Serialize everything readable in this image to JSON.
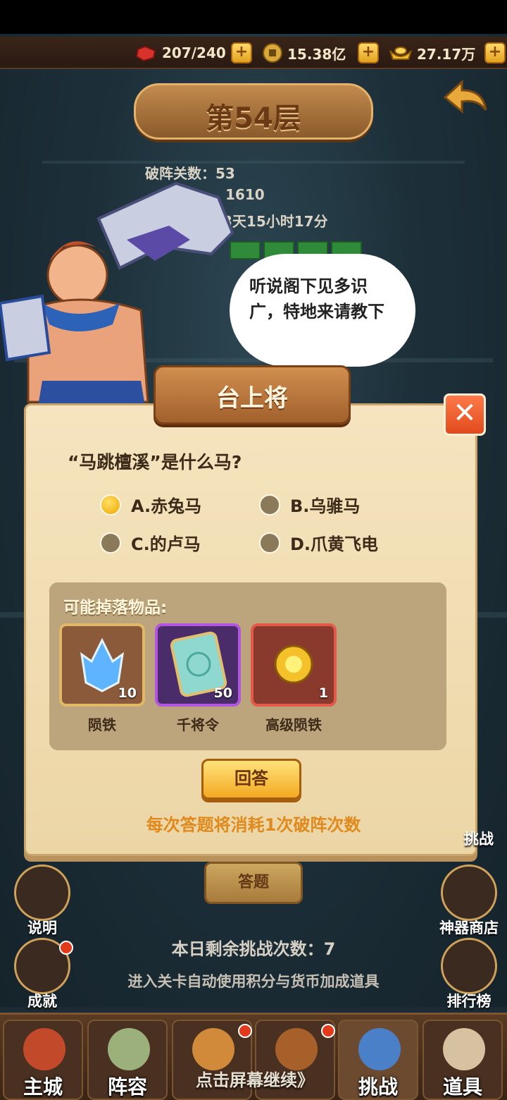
{
  "top_bar": {
    "stamina": "207/240",
    "coins": "15.38亿",
    "ingots": "27.17万",
    "plus": "+"
  },
  "floor": {
    "title": "第54层"
  },
  "info": {
    "line1": "破阵关数：53",
    "line2": "1610",
    "line3": "闭：3天15小时17分"
  },
  "speech": {
    "text": "听说阁下见多识广，特地来请教下"
  },
  "dialog": {
    "title": "台上将",
    "close": "✕",
    "question": "“马跳檀溪”是什么马?",
    "options": [
      {
        "label": "A.赤兔马",
        "selected": true
      },
      {
        "label": "B.乌骓马",
        "selected": false
      },
      {
        "label": "C.的卢马",
        "selected": false
      },
      {
        "label": "D.爪黄飞电",
        "selected": false
      }
    ],
    "drops_title": "可能掉落物品:",
    "drops": [
      {
        "name": "陨铁",
        "count": "10",
        "border": "#e0b866",
        "bg": "#8a5a3a",
        "icon": "blue-crystal-icon"
      },
      {
        "name": "千将令",
        "count": "50",
        "border": "#b255e0",
        "bg": "#4a2c6a",
        "icon": "jade-token-icon"
      },
      {
        "name": "高级陨铁",
        "count": "1",
        "border": "#e35a4a",
        "bg": "#8a3a2c",
        "icon": "golden-orb-icon"
      }
    ],
    "answer_button": "回答",
    "cost_note": "每次答题将消耗1次破阵次数"
  },
  "lower": {
    "answer_bg_button": "答题",
    "remain": "本日剩余挑战次数：7",
    "tip": "进入关卡自动使用积分与货币加成道具",
    "left_buttons": [
      {
        "label": "说明"
      },
      {
        "label": "成就"
      }
    ],
    "right_buttons": [
      {
        "label": "挑战"
      },
      {
        "label": "神器商店"
      },
      {
        "label": "排行榜"
      }
    ]
  },
  "bottom_nav": {
    "items": [
      {
        "label": "主城"
      },
      {
        "label": "阵容"
      },
      {
        "label": ""
      },
      {
        "label": ""
      },
      {
        "label": "挑战"
      },
      {
        "label": "道具"
      }
    ],
    "continue_text": "点击屏幕继续》"
  },
  "colors": {
    "accent": "#e08a1e",
    "scroll": "#f3dfb6",
    "selected_radio": "#f0a500"
  }
}
